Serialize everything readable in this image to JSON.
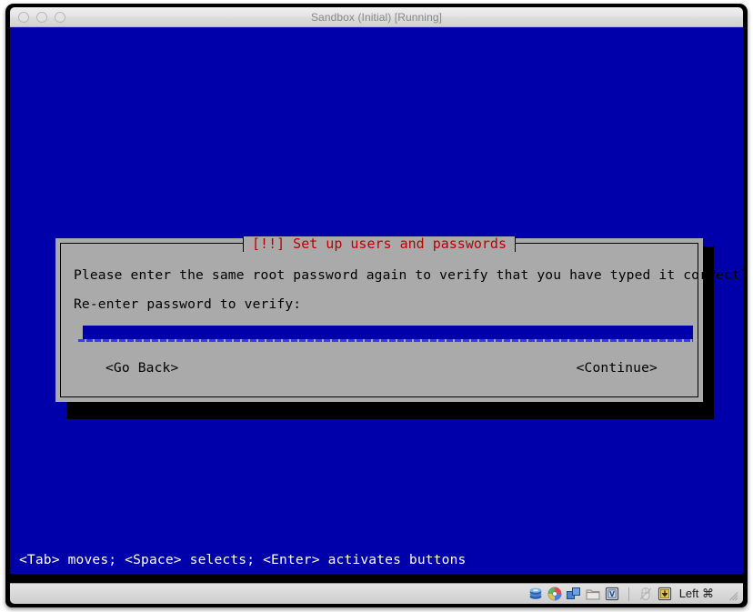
{
  "window": {
    "title": "Sandbox (Initial) [Running]",
    "traffic_lights": [
      "close",
      "minimize",
      "zoom"
    ]
  },
  "console": {
    "background_color": "#0000aa",
    "hint_line": "<Tab> moves; <Space> selects; <Enter> activates buttons"
  },
  "dialog": {
    "title": "[!!] Set up users and passwords",
    "title_color": "#bb0000",
    "background_color": "#aaaaaa",
    "message": "Please enter the same root password again to verify that you have typed it correctly.",
    "prompt_label": "Re-enter password to verify:",
    "password_value": "",
    "buttons": {
      "back": "<Go Back>",
      "continue": "<Continue>"
    }
  },
  "statusbar": {
    "icons": [
      "hard-disk-icon",
      "optical-disc-icon",
      "network-adapter-icon",
      "shared-folders-icon",
      "cpu-virtualization-icon",
      "mouse-integration-icon",
      "capture-input-icon"
    ],
    "host_key": "Left ⌘"
  }
}
